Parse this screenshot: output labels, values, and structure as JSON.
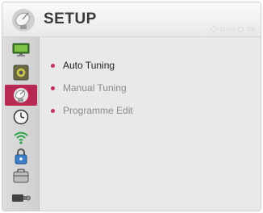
{
  "header": {
    "title": "SETUP",
    "move_label": "Move",
    "ok_label": "OK"
  },
  "sidebar": {
    "items": [
      {
        "icon": "picture-icon"
      },
      {
        "icon": "sound-icon"
      },
      {
        "icon": "setup-icon",
        "active": true
      },
      {
        "icon": "time-icon"
      },
      {
        "icon": "network-icon"
      },
      {
        "icon": "lock-icon"
      },
      {
        "icon": "option-icon"
      },
      {
        "icon": "input-icon"
      }
    ]
  },
  "menu": {
    "items": [
      {
        "label": "Auto Tuning",
        "selected": true
      },
      {
        "label": "Manual Tuning",
        "selected": false
      },
      {
        "label": "Programme Edit",
        "selected": false
      }
    ]
  },
  "colors": {
    "accent": "#b82a52",
    "bullet": "#c2315a",
    "header_bg": "#f2f2f2",
    "content_bg": "#e9e9e9"
  }
}
